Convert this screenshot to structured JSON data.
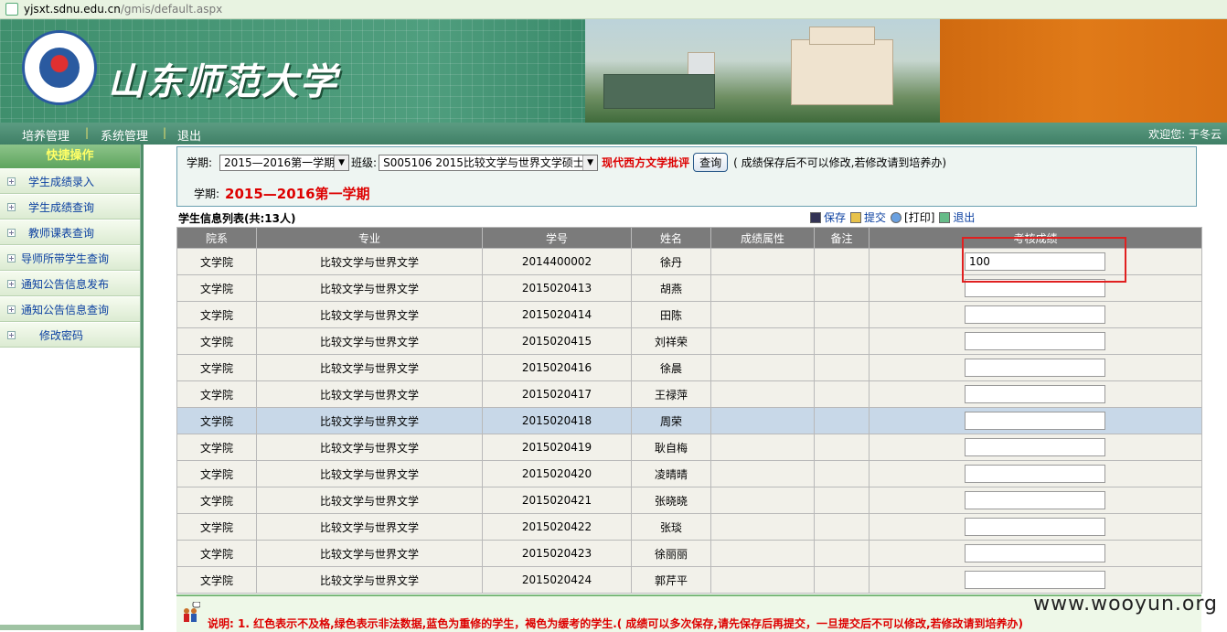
{
  "browser": {
    "url_host": "yjsxt.sdnu.edu.cn",
    "url_path": "/gmis/default.aspx"
  },
  "banner": {
    "site_title": "山东师范大学",
    "logo_text": "SHANDONG NORMAL UNIVERSITY"
  },
  "nav": {
    "items": [
      "培养管理",
      "系统管理",
      "退出"
    ],
    "separator": "|",
    "welcome": "欢迎您: 于冬云"
  },
  "sidebar": {
    "header": "快捷操作",
    "items": [
      "学生成绩录入",
      "学生成绩查询",
      "教师课表查询",
      "导师所带学生查询",
      "通知公告信息发布",
      "通知公告信息查询",
      "修改密码"
    ]
  },
  "filter": {
    "term_label": "学期:",
    "term_value": "2015—2016第一学期",
    "class_label": "班级:",
    "class_value": "S005106 2015比较文学与世界文学硕士",
    "course_name": "现代西方文学批评",
    "query_button": "查询",
    "hint": "( 成绩保存后不可以修改,若修改请到培养办)",
    "term_label2": "学期:",
    "term_display": "2015—2016第一学期"
  },
  "list": {
    "title": "学生信息列表(共:13人)",
    "actions": {
      "save": "保存",
      "submit": "提交",
      "print": "[打印]",
      "exit": "退出"
    },
    "columns": [
      "院系",
      "专业",
      "学号",
      "姓名",
      "成绩属性",
      "备注",
      "考核成绩"
    ],
    "rows": [
      {
        "dept": "文学院",
        "major": "比较文学与世界文学",
        "id": "2014400002",
        "name": "徐丹",
        "attr": "",
        "remark": "",
        "score": "100"
      },
      {
        "dept": "文学院",
        "major": "比较文学与世界文学",
        "id": "2015020413",
        "name": "胡燕",
        "attr": "",
        "remark": "",
        "score": ""
      },
      {
        "dept": "文学院",
        "major": "比较文学与世界文学",
        "id": "2015020414",
        "name": "田陈",
        "attr": "",
        "remark": "",
        "score": ""
      },
      {
        "dept": "文学院",
        "major": "比较文学与世界文学",
        "id": "2015020415",
        "name": "刘祥荣",
        "attr": "",
        "remark": "",
        "score": ""
      },
      {
        "dept": "文学院",
        "major": "比较文学与世界文学",
        "id": "2015020416",
        "name": "徐晨",
        "attr": "",
        "remark": "",
        "score": ""
      },
      {
        "dept": "文学院",
        "major": "比较文学与世界文学",
        "id": "2015020417",
        "name": "王禄萍",
        "attr": "",
        "remark": "",
        "score": ""
      },
      {
        "dept": "文学院",
        "major": "比较文学与世界文学",
        "id": "2015020418",
        "name": "周荣",
        "attr": "",
        "remark": "",
        "score": ""
      },
      {
        "dept": "文学院",
        "major": "比较文学与世界文学",
        "id": "2015020419",
        "name": "耿自梅",
        "attr": "",
        "remark": "",
        "score": ""
      },
      {
        "dept": "文学院",
        "major": "比较文学与世界文学",
        "id": "2015020420",
        "name": "凌晴晴",
        "attr": "",
        "remark": "",
        "score": ""
      },
      {
        "dept": "文学院",
        "major": "比较文学与世界文学",
        "id": "2015020421",
        "name": "张晓晓",
        "attr": "",
        "remark": "",
        "score": ""
      },
      {
        "dept": "文学院",
        "major": "比较文学与世界文学",
        "id": "2015020422",
        "name": "张琰",
        "attr": "",
        "remark": "",
        "score": ""
      },
      {
        "dept": "文学院",
        "major": "比较文学与世界文学",
        "id": "2015020423",
        "name": "徐丽丽",
        "attr": "",
        "remark": "",
        "score": ""
      },
      {
        "dept": "文学院",
        "major": "比较文学与世界文学",
        "id": "2015020424",
        "name": "郭芹平",
        "attr": "",
        "remark": "",
        "score": ""
      }
    ],
    "highlight_row": 6
  },
  "note": {
    "label": "说明:",
    "text": "1. 红色表示不及格,绿色表示非法数据,蓝色为重修的学生，褐色为缓考的学生.( 成绩可以多次保存,请先保存后再提交，一旦提交后不可以修改,若修改请到培养办)"
  },
  "watermark": "www.wooyun.org"
}
